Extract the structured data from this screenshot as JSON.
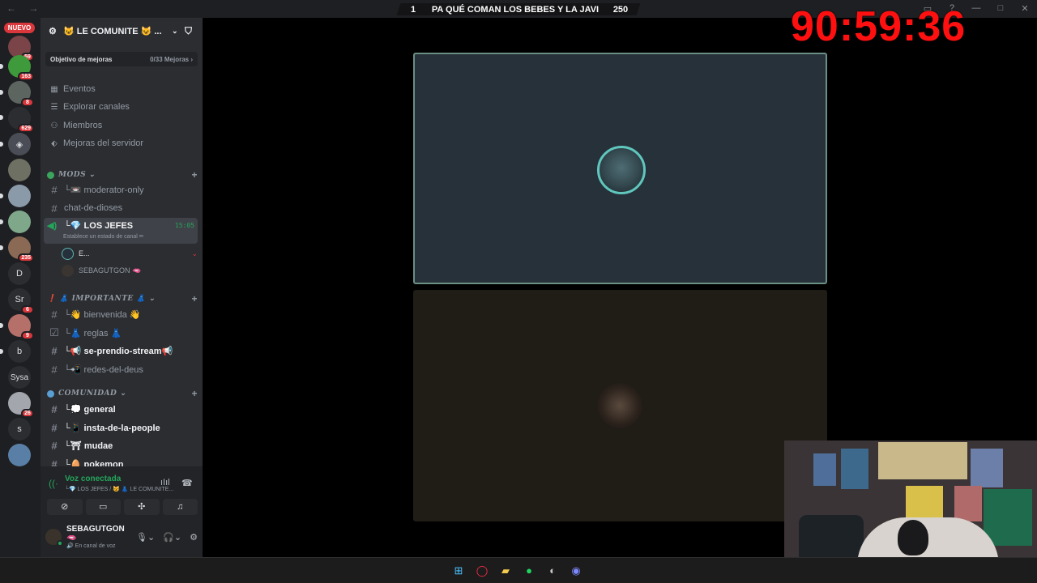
{
  "top_banner": {
    "left_number": "1",
    "text": "PA QUÉ COMAN LOS BEBES Y LA JAVI",
    "right_number": "250"
  },
  "timer": "90:59:36",
  "server_rail": {
    "new_label": "NUEVO",
    "badges": [
      "59",
      "163",
      "8",
      "629",
      "235",
      "6",
      "9",
      "26"
    ],
    "letters": [
      "D",
      "Sr",
      "b",
      "Sysa",
      "s"
    ]
  },
  "server_header": {
    "name": "😺 LE COMUNITE 😺 ..."
  },
  "boost": {
    "label": "Objetivo de mejoras",
    "value": "0/33 Mejoras ›"
  },
  "nav": [
    {
      "label": "Eventos",
      "icon": "calendar-icon"
    },
    {
      "label": "Explorar canales",
      "icon": "compass-icon"
    },
    {
      "label": "Miembros",
      "icon": "members-icon"
    },
    {
      "label": "Mejoras del servidor",
      "icon": "boost-icon"
    }
  ],
  "categories": {
    "mods": "MODS",
    "importante": "❗ 👗 IMPORTANTE 👗",
    "comunidad": "COMUNIDAD"
  },
  "channels": {
    "moderator_only": "└📼 moderator-only",
    "chat_de_dioses": "chat-de-dioses",
    "los_jefes": "└💎 LOS JEFES",
    "los_jefes_time": "15:05",
    "los_jefes_status": "Establece un estado de canal ✏",
    "voice_user_1": "E...",
    "voice_user_2": "SEBAGUTGON 🫦",
    "bienvenida": "└👋 bienvenida 👋",
    "reglas": "└👗 reglas 👗",
    "se_prendio_stream": "└📢 se-prendio-stream📢",
    "redes_del_deus": "└📲 redes-del-deus",
    "general": "└💭 general",
    "insta": "└📱 insta-de-la-people",
    "mudae": "└⛩ mudae",
    "pokemon": "└🥚 pokemon"
  },
  "voice_panel": {
    "status": "Voz conectada",
    "location": "└💎 LOS JEFES / 😺 👗 LE COMUNITE..."
  },
  "user": {
    "name": "SEBAGUTGON 🫦",
    "status": "🔊 En canal de voz"
  }
}
